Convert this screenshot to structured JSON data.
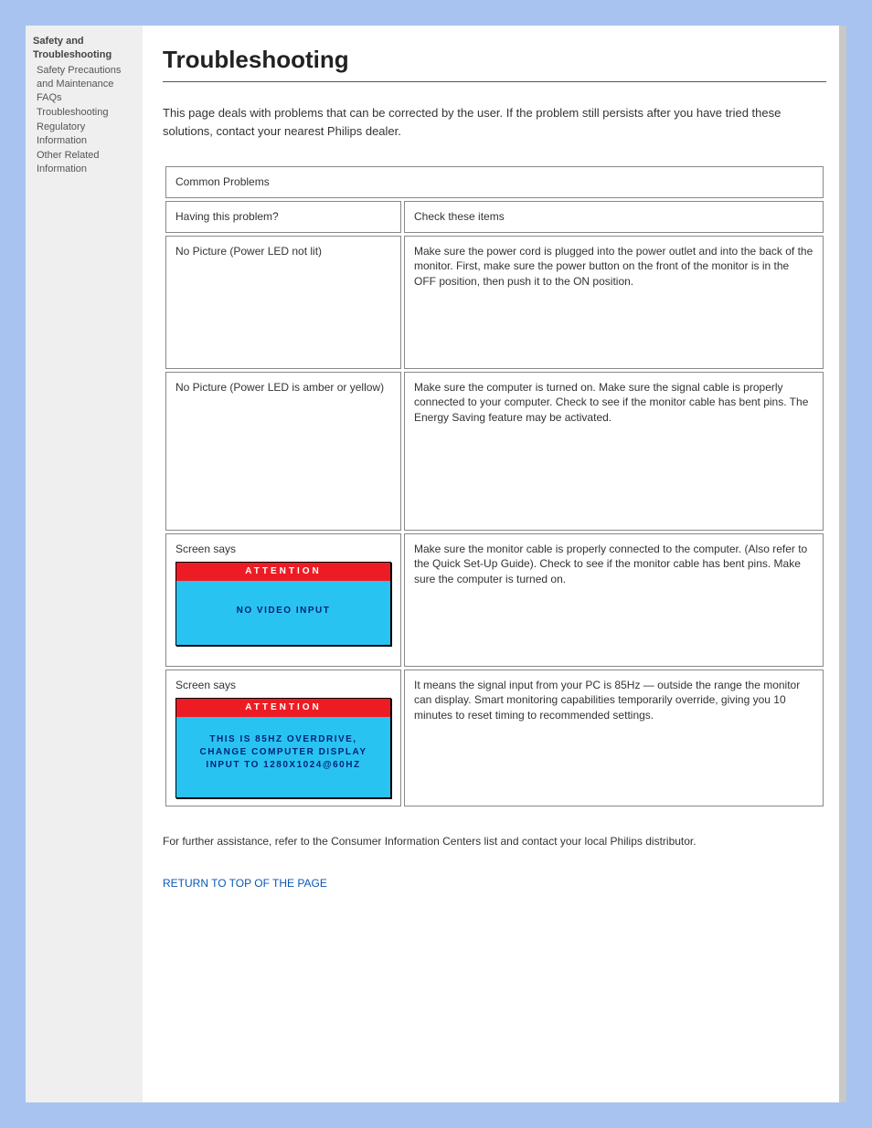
{
  "sidebar": {
    "groups": [
      {
        "header": "Safety and Troubleshooting",
        "items": [
          "Safety Precautions and Maintenance",
          "FAQs",
          "Troubleshooting",
          "Regulatory Information",
          "Other Related Information"
        ]
      }
    ]
  },
  "title": "Troubleshooting",
  "intro": "This page deals with problems that can be corrected by the user. If the problem still persists after you have tried these solutions, contact your nearest Philips dealer.",
  "table": {
    "caption": "Common Problems",
    "col1": "Having this problem?",
    "col2": "Check these items",
    "rows": [
      {
        "problem": "No Picture (Power LED not lit)",
        "fix": "Make sure the power cord is plugged into the power outlet and into the back of the monitor. First, make sure the power button on the front of the monitor is in the OFF position, then push it to the ON position."
      },
      {
        "problem": "No Picture (Power LED is amber or yellow)",
        "fix": "Make sure the computer is turned on. Make sure the signal cable is properly connected to your computer. Check to see if the monitor cable has bent pins. The Energy Saving feature may be activated."
      }
    ],
    "warn1": {
      "problem": "Screen says",
      "attention": "ATTENTION",
      "body": "NO VIDEO INPUT",
      "fix": "Make sure the monitor cable is properly connected to the computer. (Also refer to the Quick Set-Up Guide). Check to see if the monitor cable has bent pins. Make sure the computer is turned on."
    },
    "warn2": {
      "problem": "Screen says",
      "attention": "ATTENTION",
      "body_l1": "THIS IS 85HZ OVERDRIVE,",
      "body_l2": "CHANGE COMPUTER DISPLAY",
      "body_l3": "INPUT TO 1280X1024@60HZ",
      "fix": "It means the signal input from your PC is 85Hz — outside the range the monitor can display. Smart monitoring capabilities temporarily override, giving you 10 minutes to reset timing to recommended settings."
    }
  },
  "footer": {
    "text": "For further assistance, refer to the Consumer Information Centers list and contact your local Philips distributor.",
    "back": "RETURN TO TOP OF THE PAGE"
  }
}
